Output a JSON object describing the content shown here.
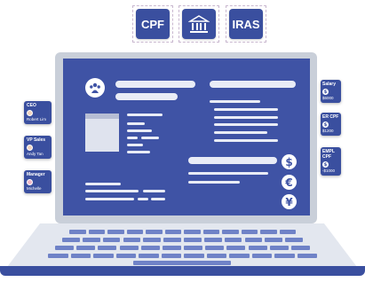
{
  "top_items": [
    {
      "label": "CPF"
    },
    {
      "label": "",
      "icon": "government-building-icon"
    },
    {
      "label": "IRAS"
    }
  ],
  "screen": {
    "logo_icon": "team-logo-icon",
    "currency_symbols": [
      "$",
      "€",
      "¥"
    ]
  },
  "left_cards": [
    {
      "title": "CEO",
      "name": "Robert Lim"
    },
    {
      "title": "VP Sales",
      "name": "Andy Tan"
    },
    {
      "title": "Manager",
      "name": "Michelle"
    }
  ],
  "right_cards": [
    {
      "title": "Salary",
      "icon": "$",
      "value": "$6000"
    },
    {
      "title": "ER CPF",
      "icon": "$",
      "value": "$1200"
    },
    {
      "title": "EMPL CPF",
      "icon": "$",
      "value": "-$1000"
    }
  ],
  "colors": {
    "primary": "#3f53a5",
    "dark": "#3a4f9f",
    "light": "#e9ecf6"
  }
}
